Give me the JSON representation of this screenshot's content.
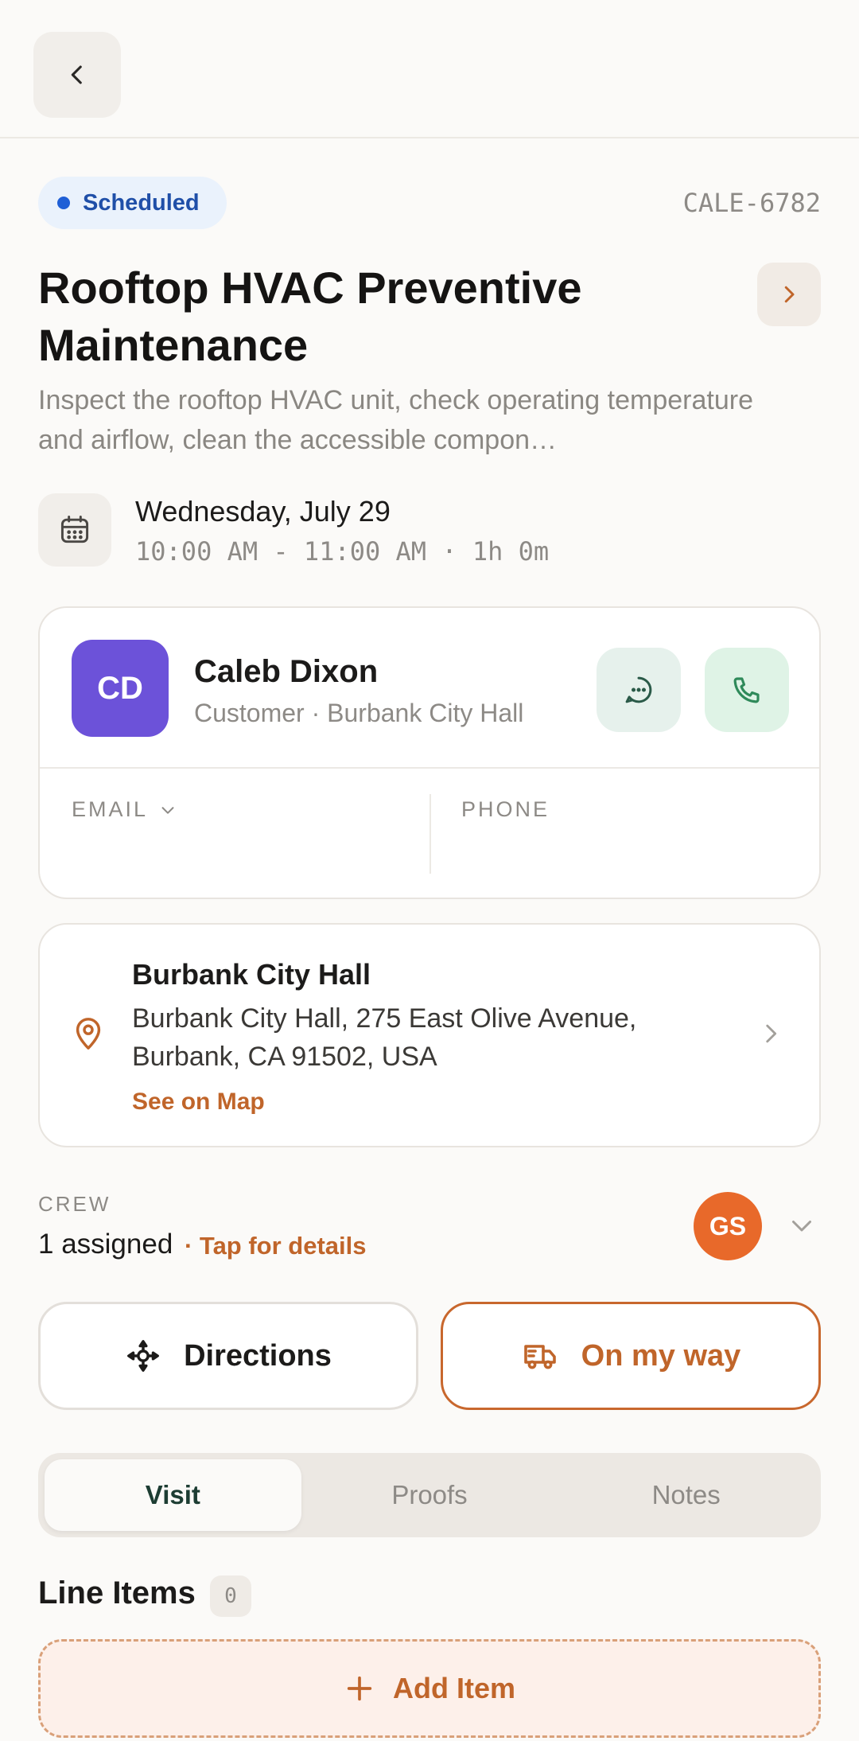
{
  "header": {
    "back_icon": "chevron-left-icon"
  },
  "job": {
    "status": "Scheduled",
    "status_color": "#1f5fd6",
    "code": "CALE-6782",
    "title": "Rooftop HVAC Preventive Maintenance",
    "description": "Inspect the rooftop HVAC unit, check operating temperature and airflow, clean the accessible compon…"
  },
  "schedule": {
    "date": "Wednesday, July 29",
    "time": "10:00 AM - 11:00 AM · 1h 0m",
    "icon": "calendar-icon"
  },
  "contact": {
    "initials": "CD",
    "name": "Caleb Dixon",
    "subtitle": "Customer · Burbank City Hall",
    "email_label": "EMAIL",
    "phone_label": "PHONE",
    "avatar_color": "#6c52d9"
  },
  "location": {
    "title": "Burbank City Hall",
    "address": "Burbank City Hall, 275 East Olive Avenue, Burbank, CA 91502, USA",
    "map_link": "See on Map"
  },
  "crew": {
    "label": "CREW",
    "count": "1 assigned",
    "tap_text": "· Tap for details",
    "member_initials": "GS",
    "member_color": "#e8692a"
  },
  "actions": {
    "directions": "Directions",
    "on_my_way": "On my way"
  },
  "tabs": [
    "Visit",
    "Proofs",
    "Notes"
  ],
  "active_tab": "Visit",
  "line_items": {
    "title": "Line Items",
    "count": "0",
    "add_label": "Add Item"
  },
  "colors": {
    "accent": "#c0652a",
    "background": "#fbfaf8"
  }
}
